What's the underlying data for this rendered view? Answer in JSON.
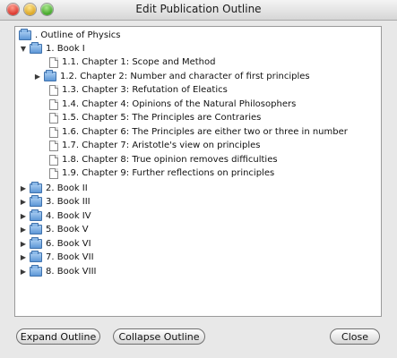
{
  "window": {
    "title": "Edit Publication Outline"
  },
  "tree": {
    "root": {
      "label": ". Outline of Physics"
    },
    "book1": {
      "label": "1. Book I"
    },
    "chapters": [
      {
        "label": "1.1. Chapter 1: Scope and Method"
      },
      {
        "label": "1.2. Chapter 2: Number and character of first principles"
      },
      {
        "label": "1.3. Chapter 3:  Refutation of Eleatics"
      },
      {
        "label": "1.4. Chapter 4:  Opinions of the Natural Philosophers"
      },
      {
        "label": "1.5. Chapter 5: The Principles are Contraries"
      },
      {
        "label": "1.6. Chapter 6:  The Principles are either two or three in number"
      },
      {
        "label": "1.7. Chapter 7:  Aristotle's view on principles"
      },
      {
        "label": "1.8. Chapter 8: True opinion removes difficulties"
      },
      {
        "label": "1.9. Chapter 9:  Further reflections on principles"
      }
    ],
    "books": [
      {
        "label": "2. Book II"
      },
      {
        "label": "3. Book III"
      },
      {
        "label": "4. Book IV"
      },
      {
        "label": "5. Book V"
      },
      {
        "label": "6. Book VI"
      },
      {
        "label": "7. Book VII"
      },
      {
        "label": "8. Book VIII"
      }
    ]
  },
  "buttons": {
    "expand": "Expand Outline",
    "collapse": "Collapse Outline",
    "close": "Close"
  }
}
